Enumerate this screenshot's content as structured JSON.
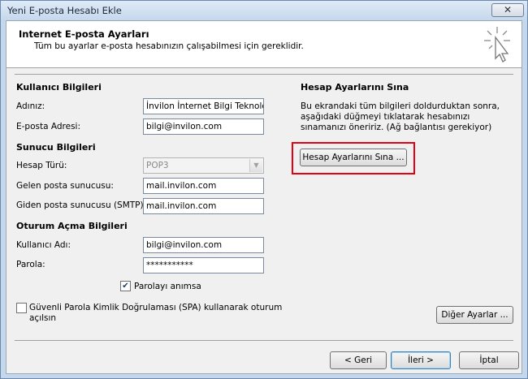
{
  "window": {
    "title": "Yeni E-posta Hesabı Ekle",
    "close_glyph": "✕"
  },
  "header": {
    "title": "Internet E-posta Ayarları",
    "subtitle": "Tüm bu ayarlar e-posta hesabınızın çalışabilmesi için gereklidir.",
    "icon": "wizard-cursor-icon"
  },
  "user_info": {
    "heading": "Kullanıcı Bilgileri",
    "name_label": "Adınız:",
    "name_value": "İnvilon İnternet Bilgi Teknolojil",
    "email_label": "E-posta Adresi:",
    "email_value": "bilgi@invilon.com"
  },
  "server_info": {
    "heading": "Sunucu Bilgileri",
    "account_type_label": "Hesap Türü:",
    "account_type_value": "POP3",
    "incoming_label": "Gelen posta sunucusu:",
    "incoming_value": "mail.invilon.com",
    "outgoing_label": "Giden posta sunucusu (SMTP):",
    "outgoing_value": "mail.invilon.com"
  },
  "logon_info": {
    "heading": "Oturum Açma Bilgileri",
    "username_label": "Kullanıcı Adı:",
    "username_value": "bilgi@invilon.com",
    "password_label": "Parola:",
    "password_value": "***********",
    "remember_label": "Parolayı anımsa",
    "remember_checked": true,
    "spa_label_line1": "Güvenli Parola Kimlik Doğrulaması (SPA) kullanarak oturum",
    "spa_label_line2": "açılsın",
    "spa_checked": false
  },
  "test": {
    "heading": "Hesap Ayarlarını Sına",
    "description": "Bu ekrandaki tüm bilgileri doldurduktan sonra, aşağıdaki düğmeyi tıklatarak hesabınızı sınamanızı öneririz. (Ağ bağlantısı gerekiyor)",
    "button_label": "Hesap Ayarlarını Sına ...",
    "highlight_color": "#e60012"
  },
  "more_settings_label": "Diğer Ayarlar ...",
  "footer": {
    "back_label": "< Geri",
    "next_label": "İleri >",
    "cancel_label": "İptal"
  }
}
